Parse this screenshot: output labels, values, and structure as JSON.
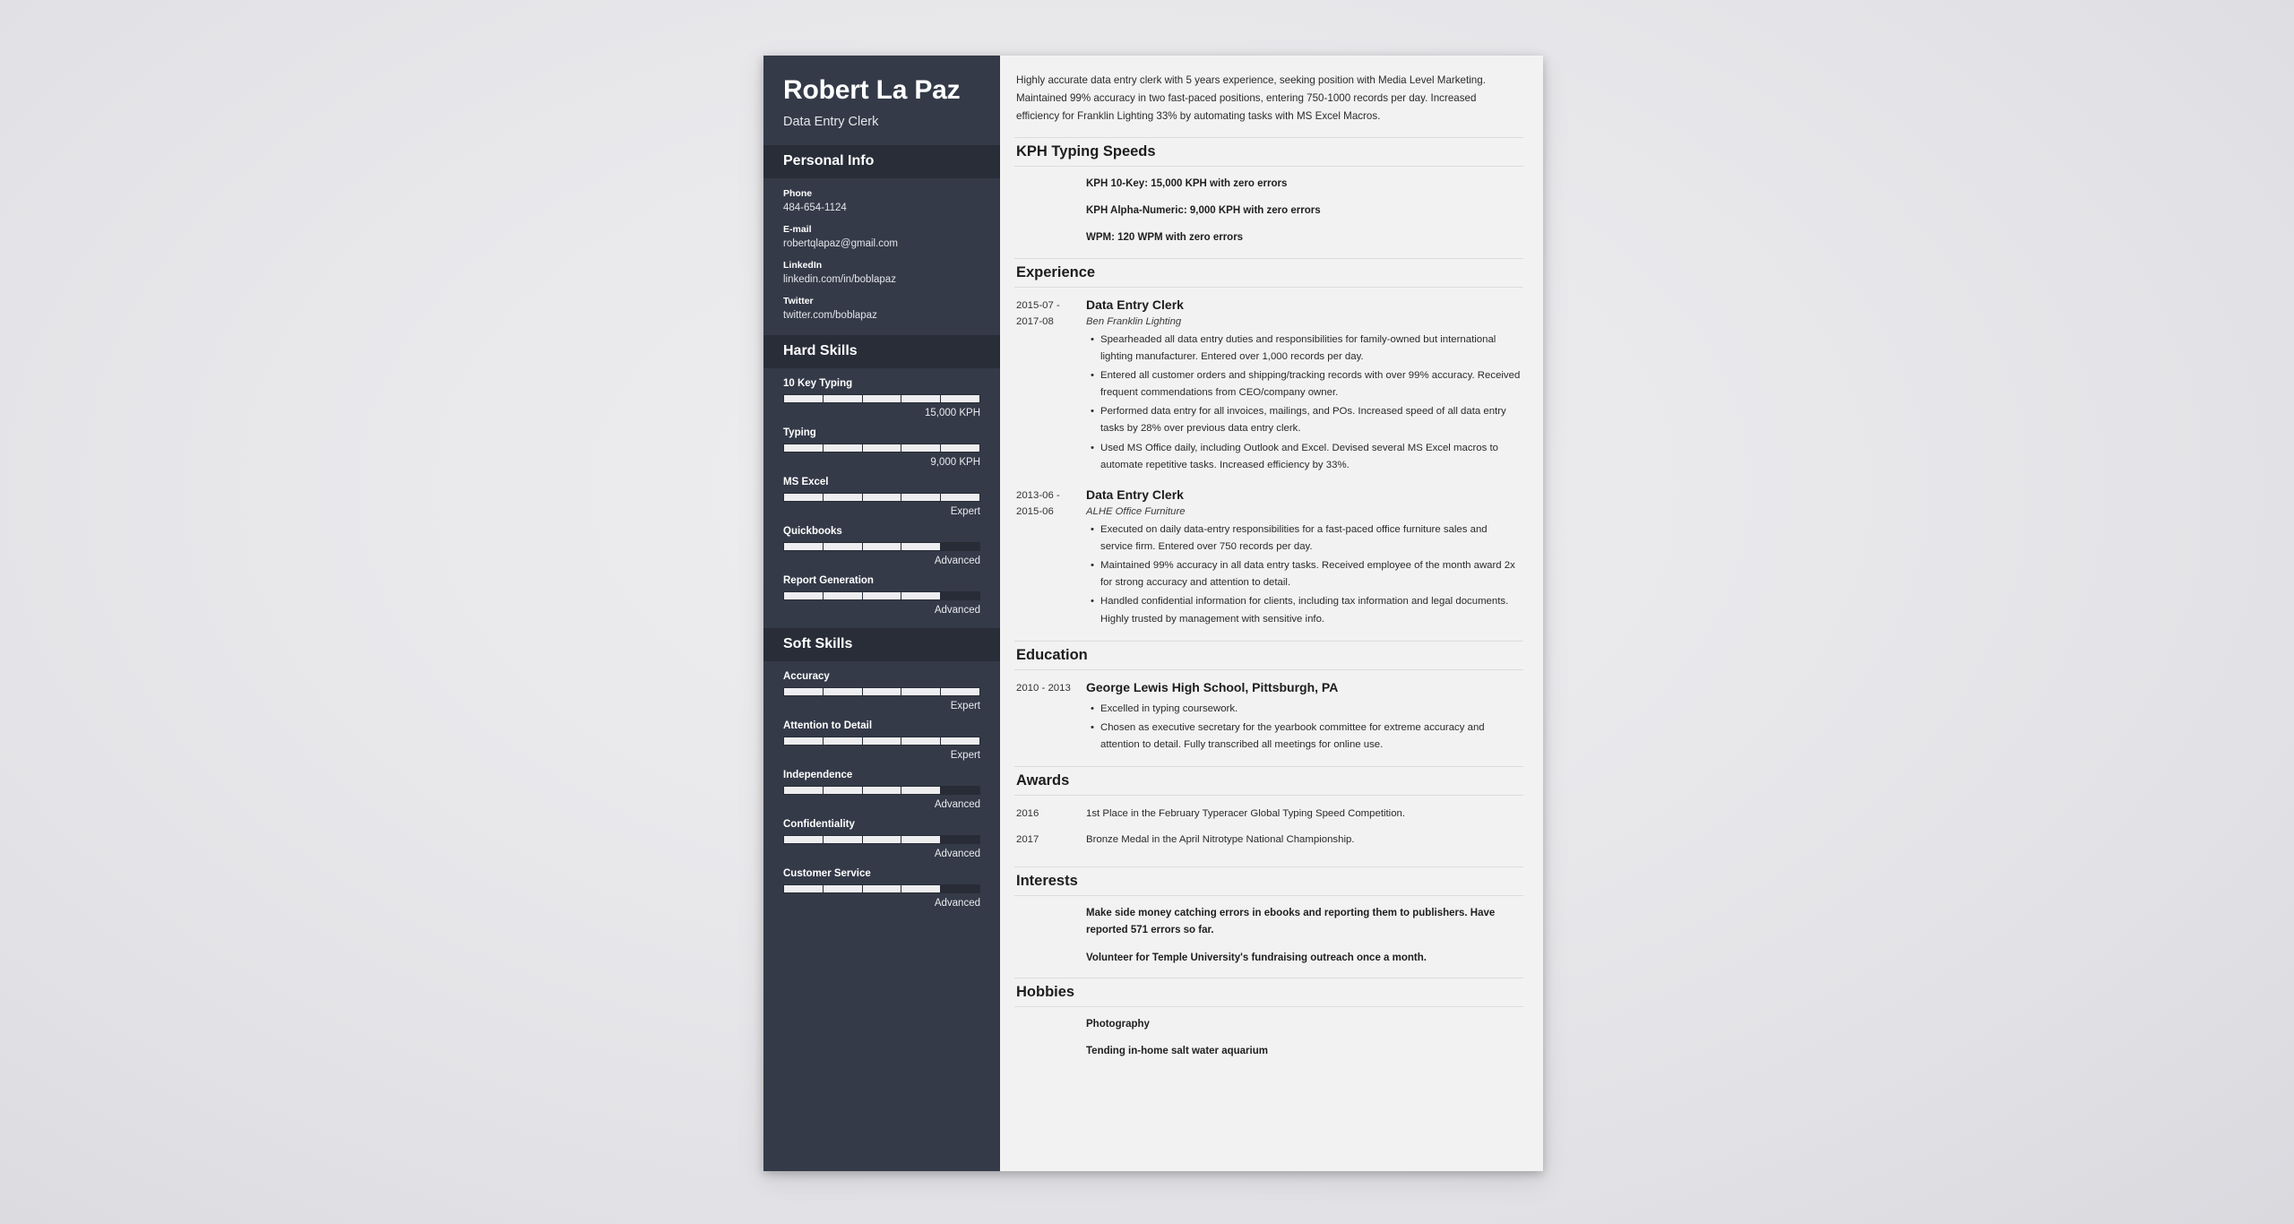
{
  "colors": {
    "sidebar_bg": "#343a48",
    "sidebar_header_bg": "#282d38",
    "page_bg": "#f2f2f2",
    "backdrop": "#e6e6e8",
    "bar_fill": "#eeeef0"
  },
  "sidebar": {
    "name": "Robert La Paz",
    "role": "Data Entry Clerk",
    "personal_info": {
      "title": "Personal Info",
      "items": [
        {
          "label": "Phone",
          "value": "484-654-1124"
        },
        {
          "label": "E-mail",
          "value": "robertqlapaz@gmail.com"
        },
        {
          "label": "LinkedIn",
          "value": "linkedin.com/in/boblapaz"
        },
        {
          "label": "Twitter",
          "value": "twitter.com/boblapaz"
        }
      ]
    },
    "hard_skills": {
      "title": "Hard Skills",
      "items": [
        {
          "name": "10 Key Typing",
          "level": "15,000 KPH",
          "filled": 5,
          "total": 5
        },
        {
          "name": "Typing",
          "level": "9,000 KPH",
          "filled": 5,
          "total": 5
        },
        {
          "name": "MS Excel",
          "level": "Expert",
          "filled": 5,
          "total": 5
        },
        {
          "name": "Quickbooks",
          "level": "Advanced",
          "filled": 4,
          "total": 5
        },
        {
          "name": "Report Generation",
          "level": "Advanced",
          "filled": 4,
          "total": 5
        }
      ]
    },
    "soft_skills": {
      "title": "Soft Skills",
      "items": [
        {
          "name": "Accuracy",
          "level": "Expert",
          "filled": 5,
          "total": 5
        },
        {
          "name": "Attention to Detail",
          "level": "Expert",
          "filled": 5,
          "total": 5
        },
        {
          "name": "Independence",
          "level": "Advanced",
          "filled": 4,
          "total": 5
        },
        {
          "name": "Confidentiality",
          "level": "Advanced",
          "filled": 4,
          "total": 5
        },
        {
          "name": "Customer Service",
          "level": "Advanced",
          "filled": 4,
          "total": 5
        }
      ]
    }
  },
  "main": {
    "summary": "Highly accurate data entry clerk with 5 years experience, seeking position with Media Level Marketing. Maintained 99% accuracy in two fast-paced positions, entering 750-1000 records per day. Increased efficiency for Franklin Lighting 33% by automating tasks with MS Excel Macros.",
    "kph": {
      "title": "KPH Typing Speeds",
      "items": [
        "KPH 10-Key: 15,000 KPH with zero errors",
        "KPH Alpha-Numeric: 9,000 KPH with zero errors",
        "WPM: 120 WPM with zero errors"
      ]
    },
    "experience": {
      "title": "Experience",
      "jobs": [
        {
          "date": "2015-07 - 2017-08",
          "title": "Data Entry Clerk",
          "org": "Ben Franklin Lighting",
          "bullets": [
            "Spearheaded all data entry duties and responsibilities for family-owned but international lighting manufacturer. Entered over 1,000 records per day.",
            "Entered all customer orders and shipping/tracking records with over 99% accuracy. Received frequent commendations from CEO/company owner.",
            "Performed data entry for all invoices, mailings, and POs. Increased speed of all data entry tasks by 28% over previous data entry clerk.",
            "Used MS Office daily, including Outlook and Excel. Devised several MS Excel macros to automate repetitive tasks. Increased efficiency by 33%."
          ]
        },
        {
          "date": "2013-06 - 2015-06",
          "title": "Data Entry Clerk",
          "org": "ALHE Office Furniture",
          "bullets": [
            "Executed on daily data-entry responsibilities for a fast-paced office furniture sales and service firm. Entered over 750 records per day.",
            "Maintained 99% accuracy in all data entry tasks. Received employee of the month award 2x for strong accuracy and attention to detail.",
            "Handled confidential information for clients, including tax information and legal documents. Highly trusted by management with sensitive info."
          ]
        }
      ]
    },
    "education": {
      "title": "Education",
      "entries": [
        {
          "date": "2010 - 2013",
          "title": "George Lewis High School, Pittsburgh, PA",
          "bullets": [
            "Excelled in typing coursework.",
            "Chosen as executive secretary for the yearbook committee for extreme accuracy and attention to detail. Fully transcribed all meetings for online use."
          ]
        }
      ]
    },
    "awards": {
      "title": "Awards",
      "entries": [
        {
          "date": "2016",
          "text": "1st Place in the February Typeracer Global Typing Speed Competition."
        },
        {
          "date": "2017",
          "text": "Bronze Medal in the April Nitrotype National Championship."
        }
      ]
    },
    "interests": {
      "title": "Interests",
      "items": [
        "Make side money catching errors in ebooks and reporting them to publishers. Have reported 571 errors so far.",
        "Volunteer for Temple University's fundraising outreach once a month."
      ]
    },
    "hobbies": {
      "title": "Hobbies",
      "items": [
        "Photography",
        "Tending in-home salt water aquarium"
      ]
    }
  }
}
